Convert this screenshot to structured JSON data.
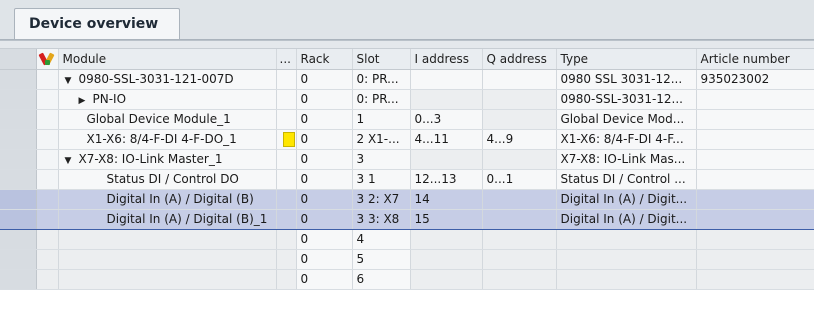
{
  "tab": {
    "label": "Device overview"
  },
  "columns": {
    "module": "Module",
    "dots": "...",
    "rack": "Rack",
    "slot": "Slot",
    "iaddress": "I address",
    "qaddress": "Q address",
    "type": "Type",
    "article": "Article number"
  },
  "rows": [
    {
      "expander": "▼",
      "module": "0980-SSL-3031-121-007D",
      "rack": "0",
      "slot": "0: PR...",
      "i": "",
      "q": "",
      "type": "0980 SSL 3031-12...",
      "article": "935023002"
    },
    {
      "expander": "▶",
      "module": "PN-IO",
      "rack": "0",
      "slot": "0: PR...",
      "i": "",
      "q": "",
      "type": "0980-SSL-3031-12...",
      "article": ""
    },
    {
      "expander": "",
      "module": "Global Device Module_1",
      "rack": "0",
      "slot": "1",
      "i": "0...3",
      "q": "",
      "type": "Global Device Mod...",
      "article": ""
    },
    {
      "expander": "",
      "module": "X1-X6: 8/4-F-DI 4-F-DO_1",
      "rack": "0",
      "slot": "2 X1-...",
      "i": "4...11",
      "q": "4...9",
      "type": "X1-X6: 8/4-F-DI 4-F...",
      "article": ""
    },
    {
      "expander": "▼",
      "module": "X7-X8: IO-Link Master_1",
      "rack": "0",
      "slot": "3",
      "i": "",
      "q": "",
      "type": "X7-X8: IO-Link Mas...",
      "article": ""
    },
    {
      "expander": "",
      "module": "Status DI / Control DO",
      "rack": "0",
      "slot": "3 1",
      "i": "12...13",
      "q": "0...1",
      "type": "Status DI / Control ...",
      "article": ""
    },
    {
      "expander": "",
      "module": "Digital In (A) / Digital (B)",
      "rack": "0",
      "slot": "3 2: X7",
      "i": "14",
      "q": "",
      "type": "Digital In (A) / Digit...",
      "article": ""
    },
    {
      "expander": "",
      "module": "Digital In (A) / Digital (B)_1",
      "rack": "0",
      "slot": "3 3: X8",
      "i": "15",
      "q": "",
      "type": "Digital In (A) / Digit...",
      "article": ""
    },
    {
      "rack": "0",
      "slot": "4"
    },
    {
      "rack": "0",
      "slot": "5"
    },
    {
      "rack": "0",
      "slot": "6"
    }
  ],
  "icons": {
    "header": "wrench-screwdriver-icon",
    "status": "yellow-status-icon"
  }
}
